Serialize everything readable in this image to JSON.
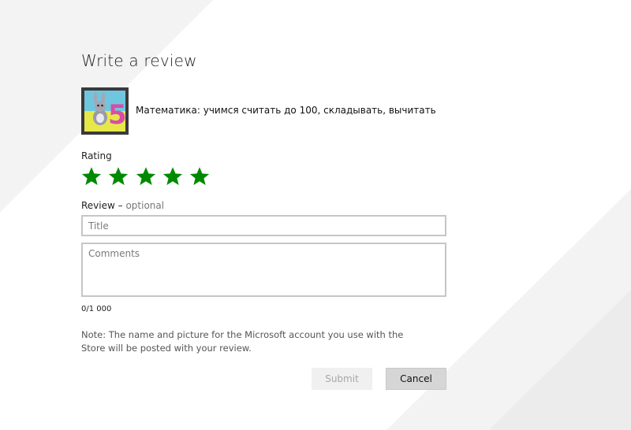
{
  "dialog": {
    "title": "Write a review",
    "app_name": "Математика: учимся считать до 100, складывать, вычитать",
    "rating": {
      "label": "Rating",
      "value": 5,
      "max": 5,
      "star_color": "#008a00"
    },
    "review": {
      "label": "Review –",
      "optional_label": "optional",
      "title_placeholder": "Title",
      "comments_placeholder": "Comments",
      "counter": "0/1 000"
    },
    "note": "Note: The name and picture for the Microsoft account you use with the Store will be posted with your review.",
    "buttons": {
      "submit_label": "Submit",
      "cancel_label": "Cancel"
    }
  }
}
